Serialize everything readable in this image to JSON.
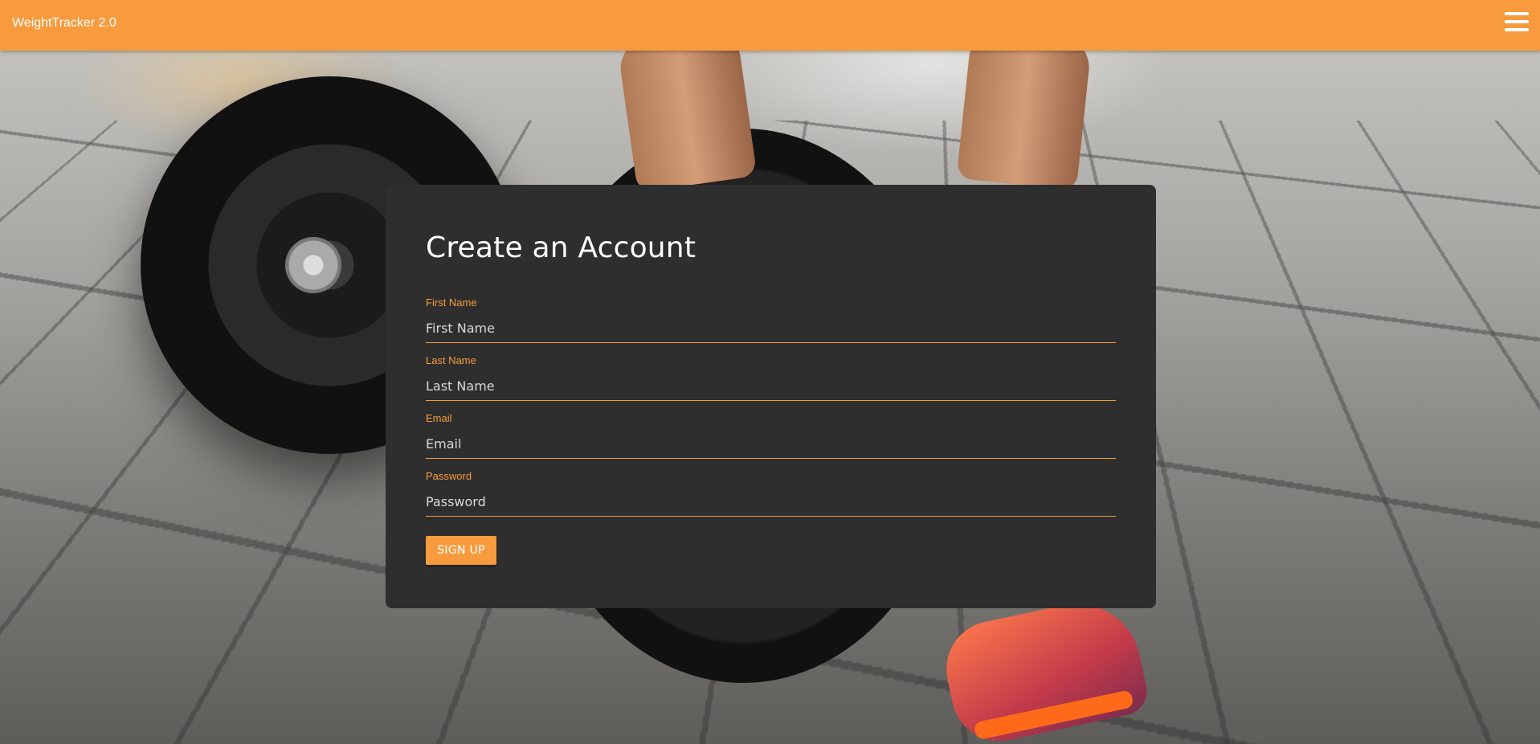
{
  "navbar": {
    "brand": "WeightTracker 2.0",
    "menu_icon": "hamburger-menu-icon"
  },
  "signup": {
    "title": "Create an Account",
    "fields": [
      {
        "label": "First Name",
        "placeholder": "First Name",
        "value": ""
      },
      {
        "label": "Last Name",
        "placeholder": "Last Name",
        "value": ""
      },
      {
        "label": "Email",
        "placeholder": "Email",
        "value": ""
      },
      {
        "label": "Password",
        "placeholder": "Password",
        "value": ""
      }
    ],
    "submit_label": "SIGN UP"
  },
  "colors": {
    "accent": "#f79b3e",
    "card_bg": "#2e2e2e",
    "text": "#ffffff"
  }
}
